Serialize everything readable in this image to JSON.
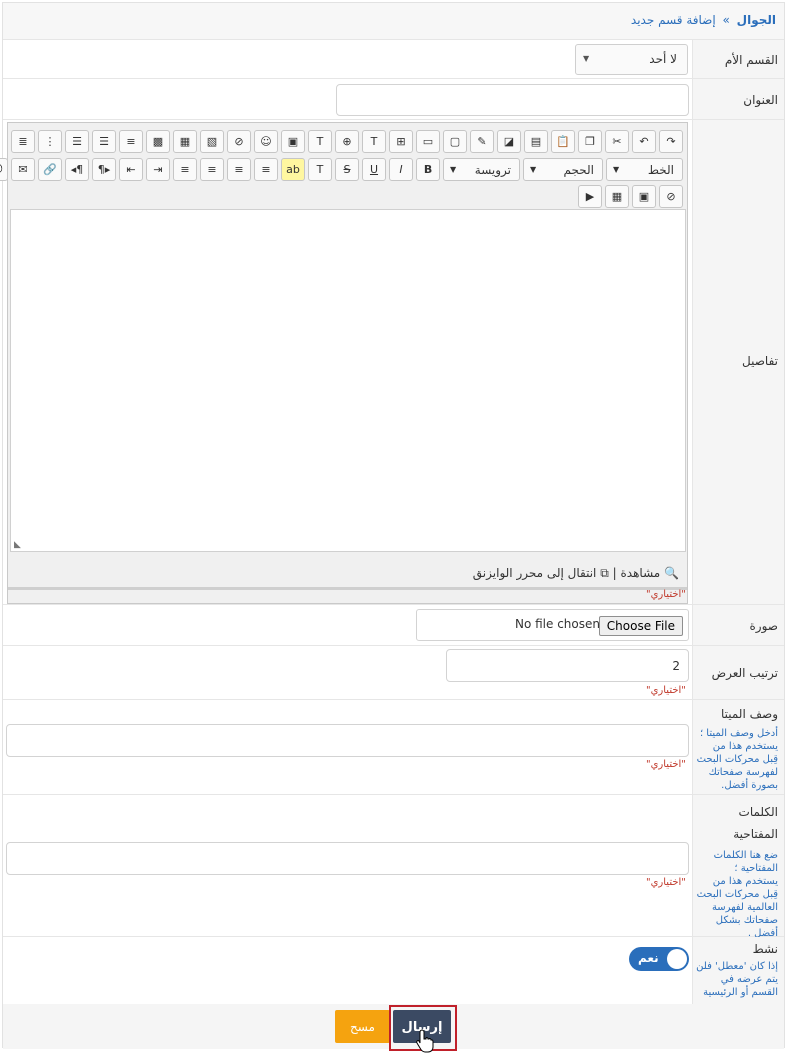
{
  "breadcrumb": {
    "home": "الجوال",
    "separator": "»",
    "current": "إضافة قسم جديد"
  },
  "parent": {
    "label": "القسم الأم",
    "value": "لا أحد"
  },
  "title": {
    "label": "العنوان",
    "value": ""
  },
  "details": {
    "label": "تفاصيل",
    "font_combo": "الخط",
    "size_combo": "الحجم",
    "format_combo": "ترويسة",
    "preview": "مشاهدة",
    "wysiwyg": "انتقال إلى محرر الوايزنق",
    "status_sep": "|",
    "optional": "\"اختياري\""
  },
  "image": {
    "label": "صورة",
    "button": "Choose File",
    "status": "No file chosen"
  },
  "order": {
    "label": "ترتيب العرض",
    "value": "2",
    "optional": "\"اختياري\""
  },
  "meta_desc": {
    "label": "وصف الميتا",
    "hint_lines": [
      "أدخل وصف الميتا ؛",
      "يستخدم هذا من",
      "قِبل محركات البحث",
      "لفهرسة صفحاتك",
      "بصورة أفضل."
    ],
    "value": "",
    "optional": "\"اختياري\""
  },
  "keywords": {
    "label_lines": [
      "الكلمات",
      "المفتاحية"
    ],
    "hint_lines": [
      "ضع هنا الكلمات",
      "المفتاحية ؛",
      "يستخدم هذا من",
      "قِبل محركات البحث",
      "العالمية لفهرسة",
      "صفحاتك بشكل",
      "أفضل ."
    ],
    "value": "",
    "optional": "\"اختياري\""
  },
  "active": {
    "label": "نشط",
    "hint_lines": [
      "إذا كان 'معطل' فلن",
      "يتم عرضه في",
      "القسم أو الرئيسية"
    ],
    "toggle": "نعم"
  },
  "actions": {
    "submit": "إرسال",
    "clear": "مسح"
  },
  "colors": {
    "accent": "#2a6ebb",
    "submit": "#3b4a63",
    "clear": "#f5a30f",
    "optional": "#c0392b"
  }
}
